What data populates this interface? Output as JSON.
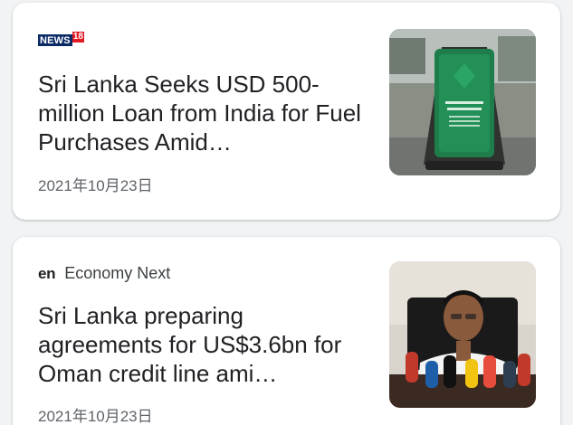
{
  "articles": [
    {
      "source": {
        "logo_text": "NEWS",
        "logo_badge": "18",
        "name": ""
      },
      "headline": "Sri Lanka Seeks USD 500-million Loan from India for Fuel Purchases Amid…",
      "date": "2021年10月23日",
      "thumbnail": "fuel-station-sign-image"
    },
    {
      "source": {
        "logo_text": "en",
        "name": "Economy Next"
      },
      "headline": "Sri Lanka preparing agreements for US$3.6bn for Oman credit line ami…",
      "date": "2021年10月23日",
      "thumbnail": "press-conference-speaker-image"
    }
  ],
  "colors": {
    "background": "#f1f3f4",
    "card": "#ffffff",
    "headline": "#202124",
    "meta": "#5f6368",
    "news18_blue": "#0a2a66",
    "news18_red": "#e31b23"
  }
}
